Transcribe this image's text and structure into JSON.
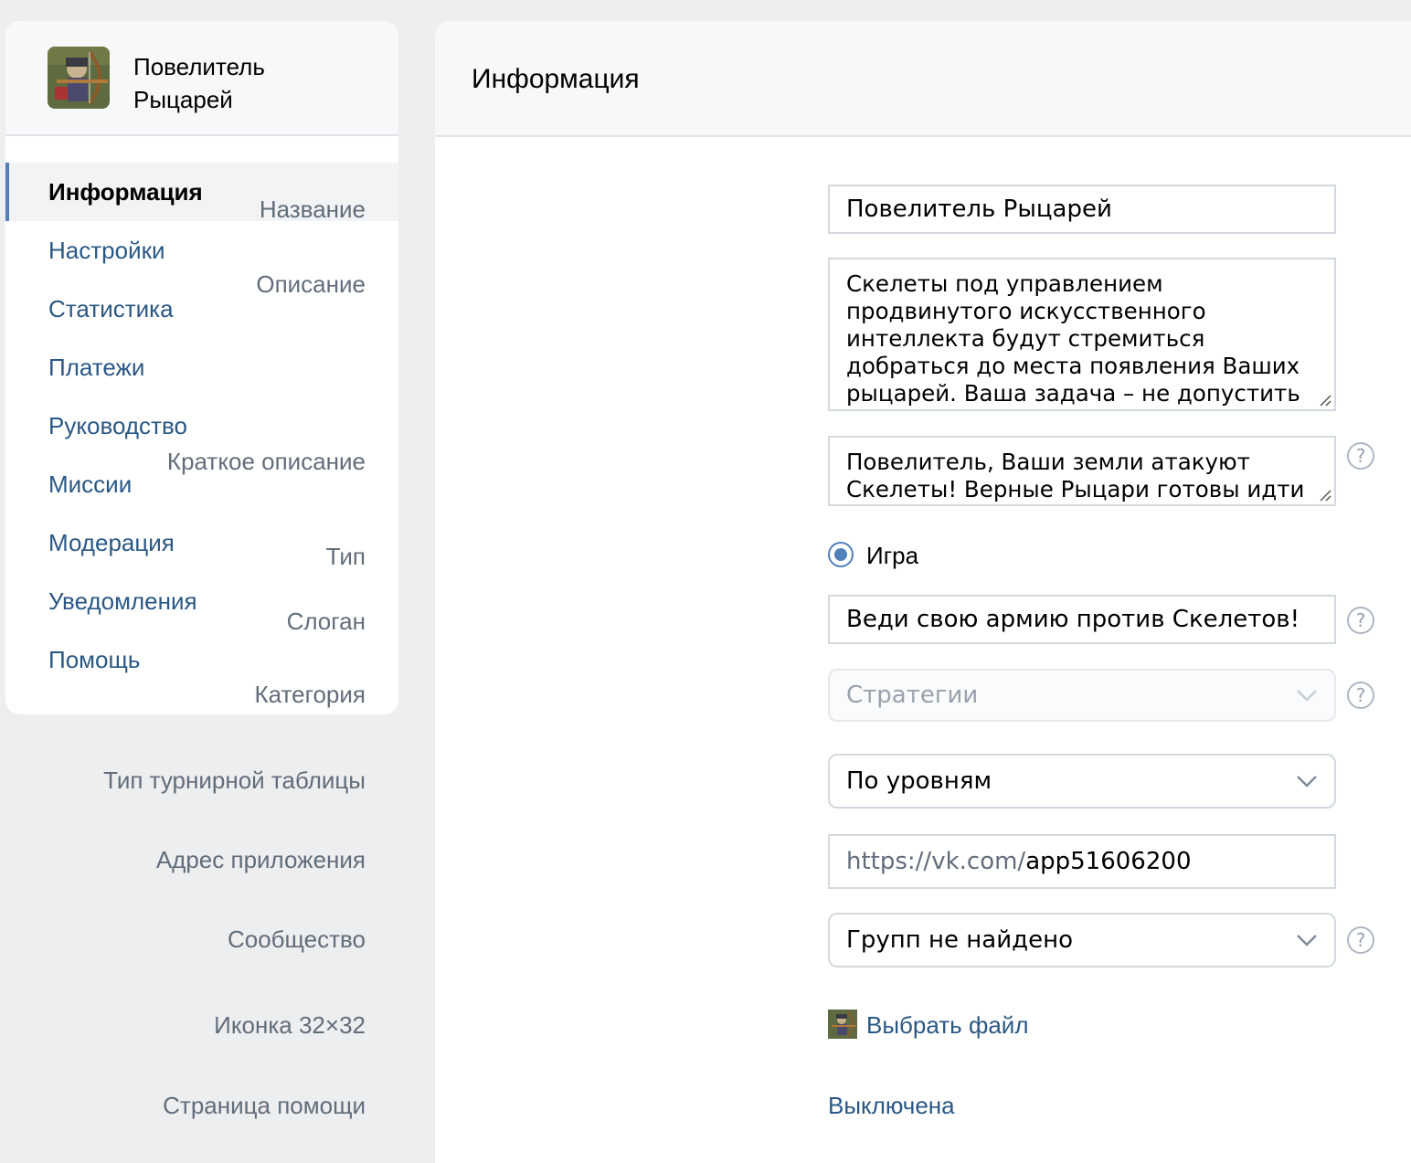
{
  "app": {
    "title": "Повелитель Рыцарей",
    "icon": "knight-archer-pixel-icon"
  },
  "sidebar": {
    "items": [
      {
        "label": "Информация",
        "active": true
      },
      {
        "label": "Настройки"
      },
      {
        "label": "Статистика"
      },
      {
        "label": "Платежи"
      },
      {
        "label": "Руководство"
      },
      {
        "label": "Миссии"
      },
      {
        "label": "Модерация"
      },
      {
        "label": "Уведомления"
      },
      {
        "label": "Помощь"
      }
    ]
  },
  "main": {
    "title": "Информация",
    "form": {
      "name": {
        "label": "Название",
        "value": "Повелитель Рыцарей"
      },
      "description": {
        "label": "Описание",
        "value": "Скелеты под управлением продвинутого искусственного интеллекта будут стремиться добраться до места появления Ваших рыцарей. Ваша задача – не допустить это и"
      },
      "short_description": {
        "label": "Краткое описание",
        "value": "Повелитель, Ваши земли атакуют Скелеты! Верные Рыцари готовы идти"
      },
      "type": {
        "label": "Тип",
        "option": "Игра",
        "selected": true
      },
      "slogan": {
        "label": "Слоган",
        "value": "Веди свою армию против Скелетов!"
      },
      "category": {
        "label": "Категория",
        "value": "Стратегии",
        "disabled": true
      },
      "leaderboard_type": {
        "label": "Тип турнирной таблицы",
        "value": "По уровням"
      },
      "app_address": {
        "label": "Адрес приложения",
        "prefix": "https://vk.com/",
        "value": "app51606200"
      },
      "community": {
        "label": "Сообщество",
        "value": "Групп не найдено"
      },
      "icon32": {
        "label": "Иконка 32×32",
        "action": "Выбрать файл"
      },
      "help_page": {
        "label": "Страница помощи",
        "value": "Выключена"
      }
    },
    "help_glyph": "?"
  },
  "colors": {
    "link": "#2a5885",
    "accent": "#5181b8",
    "label": "#626d7a",
    "background": "#edeef0"
  }
}
